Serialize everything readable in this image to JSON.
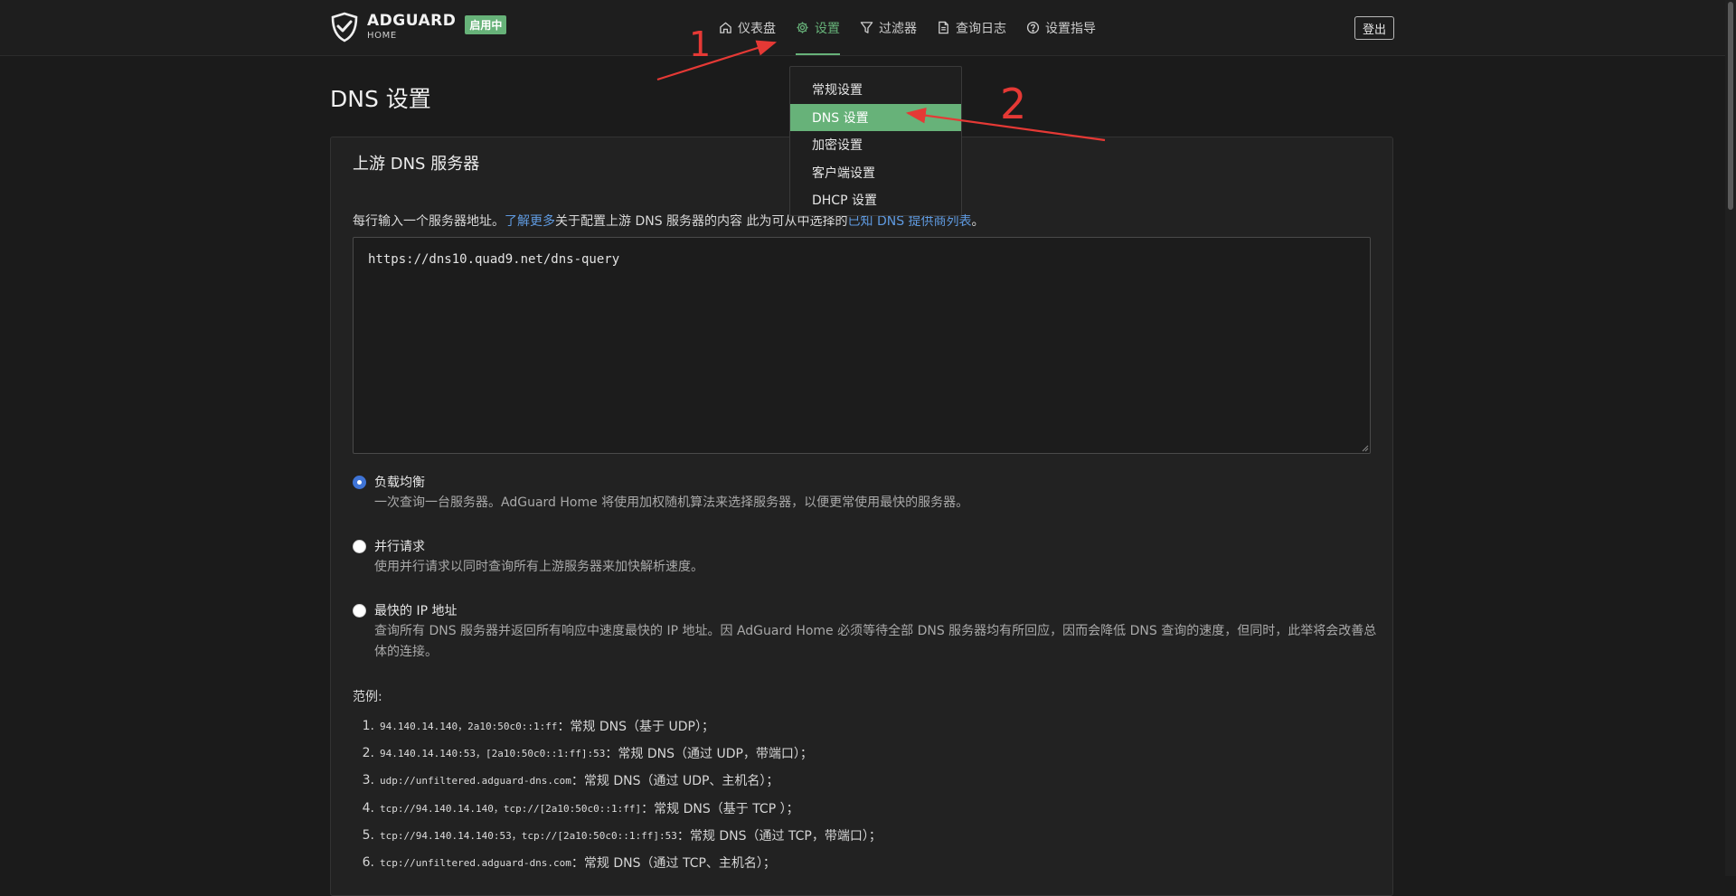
{
  "brand": {
    "name": "ADGUARD",
    "sub": "HOME",
    "badge": "启用中"
  },
  "nav": [
    {
      "label": "仪表盘",
      "icon": "home-icon"
    },
    {
      "label": "设置",
      "icon": "gear-icon",
      "active": true
    },
    {
      "label": "过滤器",
      "icon": "filter-icon"
    },
    {
      "label": "查询日志",
      "icon": "document-icon"
    },
    {
      "label": "设置指导",
      "icon": "help-icon"
    }
  ],
  "logout_label": "登出",
  "dropdown": [
    {
      "label": "常规设置"
    },
    {
      "label": "DNS 设置",
      "active": true
    },
    {
      "label": "加密设置"
    },
    {
      "label": "客户端设置"
    },
    {
      "label": "DHCP 设置"
    }
  ],
  "page_title": "DNS 设置",
  "card": {
    "title": "上游 DNS 服务器",
    "desc_pre": "每行输入一个服务器地址。",
    "desc_link1": "了解更多",
    "desc_mid": "关于配置上游 DNS 服务器的内容 此为可从中选择的",
    "desc_link2": "已知 DNS 提供商列表",
    "desc_post": "。",
    "upstream_value": "https://dns10.quad9.net/dns-query"
  },
  "modes": [
    {
      "label": "负载均衡",
      "desc": "一次查询一台服务器。AdGuard Home 将使用加权随机算法来选择服务器，以便更常使用最快的服务器。",
      "checked": true
    },
    {
      "label": "并行请求",
      "desc": "使用并行请求以同时查询所有上游服务器来加快解析速度。",
      "checked": false
    },
    {
      "label": "最快的 IP 地址",
      "desc": "查询所有 DNS 服务器并返回所有响应中速度最快的 IP 地址。因 AdGuard Home 必须等待全部 DNS 服务器均有所回应，因而会降低 DNS 查询的速度，但同时，此举将会改善总体的连接。",
      "checked": false
    }
  ],
  "examples_title": "范例:",
  "examples": [
    {
      "num": "1.",
      "code": "94.140.14.140，2a10:50c0::1:ff",
      "text": "：常规 DNS（基于 UDP）；"
    },
    {
      "num": "2.",
      "code": "94.140.14.140:53，[2a10:50c0::1:ff]:53",
      "text": "：常规 DNS（通过 UDP，带端口）；"
    },
    {
      "num": "3.",
      "code": "udp://unfiltered.adguard-dns.com",
      "text": "：常规 DNS（通过 UDP、主机名）；"
    },
    {
      "num": "4.",
      "code": "tcp://94.140.14.140，tcp://[2a10:50c0::1:ff]",
      "text": "：常规 DNS（基于 TCP ）；"
    },
    {
      "num": "5.",
      "code": "tcp://94.140.14.140:53，tcp://[2a10:50c0::1:ff]:53",
      "text": "：常规 DNS（通过 TCP，带端口）；"
    },
    {
      "num": "6.",
      "code": "tcp://unfiltered.adguard-dns.com",
      "text": "：常规 DNS（通过 TCP、主机名）；"
    }
  ],
  "annotations": {
    "step1": "1",
    "step2": "2",
    "color": "#e53935"
  },
  "colors": {
    "accent": "#67b279",
    "link": "#5f9ae0",
    "radio": "#3f74d6",
    "background": "#1b1b1b"
  }
}
